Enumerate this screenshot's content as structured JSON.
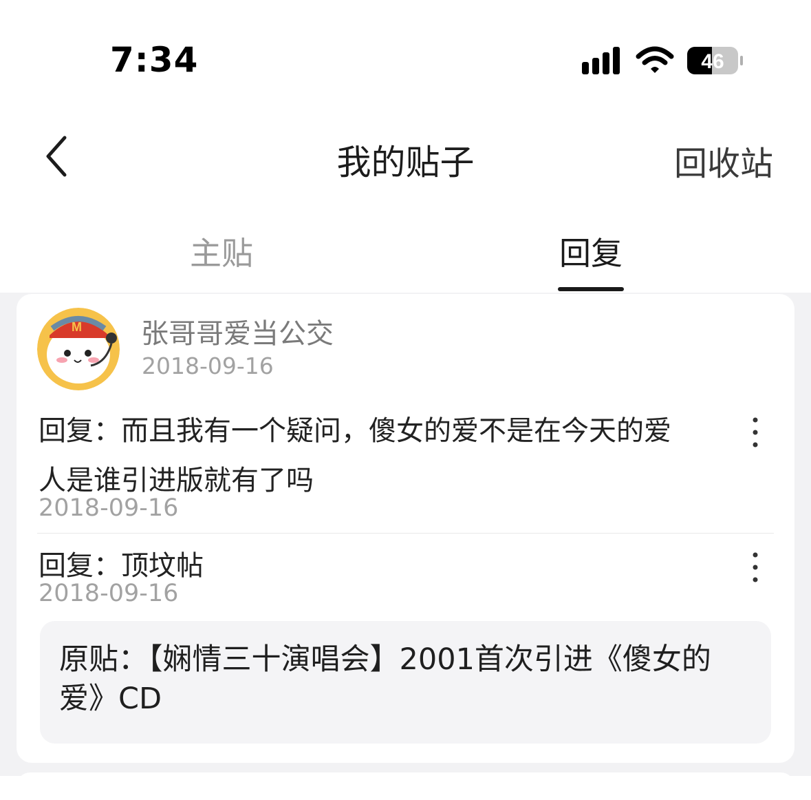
{
  "status_bar": {
    "time": "7:34",
    "battery_level": "46",
    "icons": [
      "signal-icon",
      "wifi-icon",
      "battery-icon"
    ]
  },
  "nav": {
    "title": "我的贴子",
    "right_action": "回收站",
    "back_icon": "chevron-left-icon"
  },
  "tabs": [
    {
      "label": "主贴",
      "active": false
    },
    {
      "label": "回复",
      "active": true
    }
  ],
  "post": {
    "username": "张哥哥爱当公交",
    "date": "2018-09-16",
    "replies": [
      {
        "text": "回复：而且我有一个疑问，傻女的爱不是在今天的爱人是谁引进版就有了吗",
        "date": "2018-09-16"
      },
      {
        "text": "回复：顶坟帖",
        "date": "2018-09-16"
      }
    ],
    "original": "原贴：【娴情三十演唱会】2001首次引进《傻女的爱》CD"
  },
  "colors": {
    "accent": "#1a1a1a",
    "muted_text": "#a2a2a2",
    "background": "#f2f2f4",
    "card": "#ffffff"
  }
}
